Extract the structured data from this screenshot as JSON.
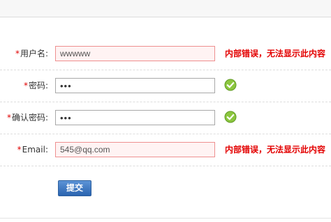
{
  "form": {
    "required_mark": "*",
    "fields": [
      {
        "label": "用户名:",
        "value": "wwwww",
        "status": "error",
        "error_text": "内部错误，无法显示此内容"
      },
      {
        "label": "密码:",
        "value": "•••",
        "status": "ok",
        "type": "password"
      },
      {
        "label": "确认密码:",
        "value": "•••",
        "status": "ok",
        "type": "password"
      },
      {
        "label": "Email:",
        "value": "545@qq.com",
        "status": "error",
        "error_text": "内部错误，无法显示此内容"
      }
    ],
    "submit_label": "提交"
  },
  "colors": {
    "error_text": "#e30000",
    "error_field_bg": "#fff3f3",
    "error_field_border": "#ee8f8f",
    "ok_icon": "#8cc63f",
    "button": "#2a64b0"
  },
  "icons": {
    "ok": "check-circle-icon"
  }
}
